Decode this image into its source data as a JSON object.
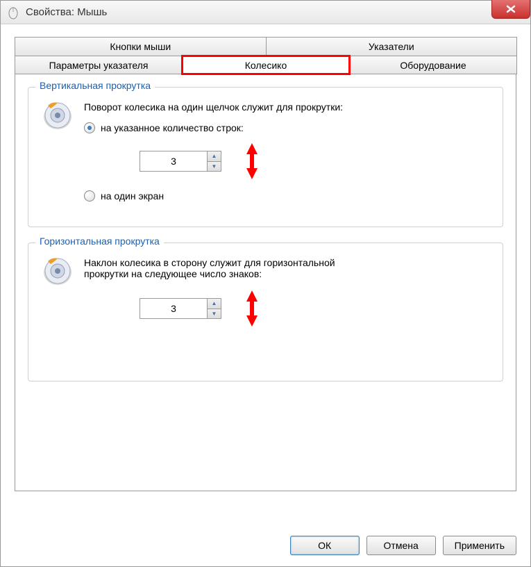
{
  "window": {
    "title": "Свойства: Мышь"
  },
  "tabs": {
    "row1": [
      "Кнопки мыши",
      "Указатели"
    ],
    "row2": [
      "Параметры указателя",
      "Колесико",
      "Оборудование"
    ],
    "active": "Колесико"
  },
  "vertical_group": {
    "title": "Вертикальная прокрутка",
    "description": "Поворот колесика на один щелчок служит для прокрутки:",
    "radio_lines": "на указанное количество строк:",
    "radio_screen": "на один экран",
    "lines_value": "3",
    "radio_selected": "lines"
  },
  "horizontal_group": {
    "title": "Горизонтальная прокрутка",
    "description": "Наклон колесика в сторону служит для горизонтальной прокрутки на следующее число знаков:",
    "chars_value": "3"
  },
  "buttons": {
    "ok": "ОК",
    "cancel": "Отмена",
    "apply": "Применить"
  },
  "icons": {
    "mouse": "mouse-icon",
    "close": "close-icon",
    "wheel": "wheel-icon",
    "arrows": "red-double-arrow-icon"
  }
}
